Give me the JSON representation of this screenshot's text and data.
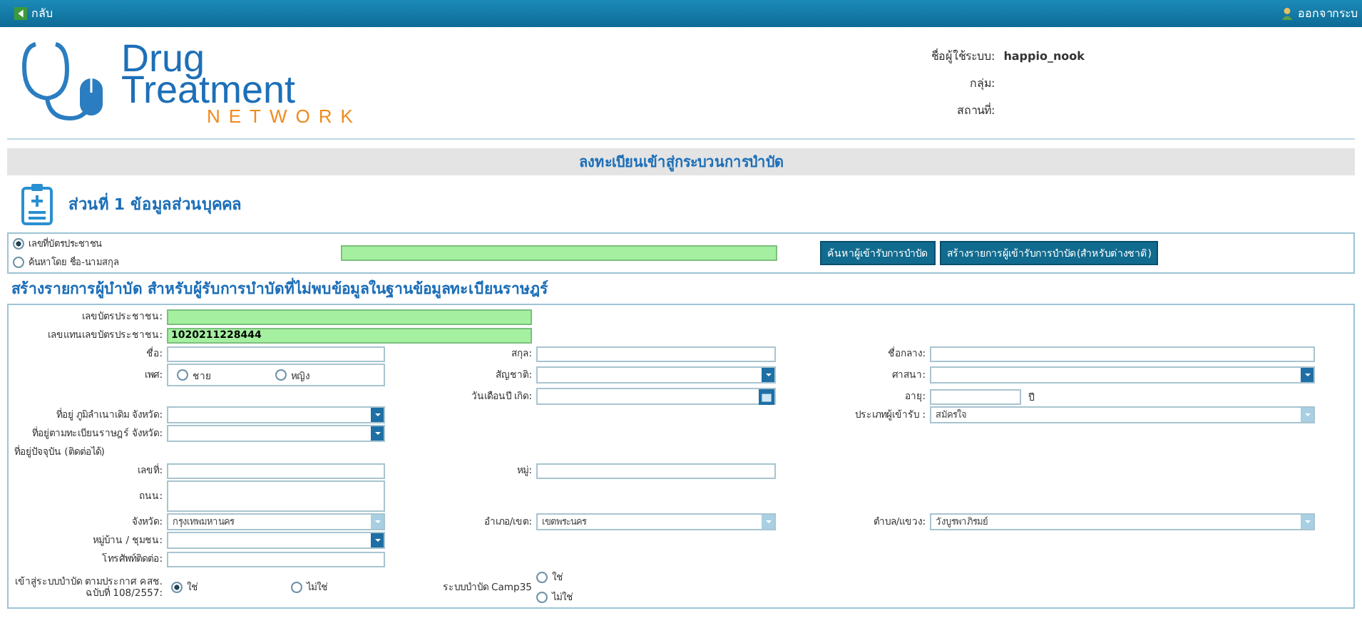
{
  "top_bar": {
    "back": "กลับ",
    "logout": "ออกจากระบ"
  },
  "header": {
    "logo": {
      "line1": "Drug",
      "line2": "Treatment",
      "line3": "NETWORK"
    },
    "user_info": [
      {
        "label": "ชื่อผู้ใช้ระบบ:",
        "value": "happio_nook"
      },
      {
        "label": "กลุ่ม:"
      },
      {
        "label": "สถานที่:"
      }
    ]
  },
  "page_title": "ลงทะเบียนเข้าสู่กระบวนการบำบัด",
  "section_title": "ส่วนที่ 1 ข้อมูลส่วนบุคคล",
  "search": {
    "options": [
      {
        "label": "เลขที่บัตรประชาชน",
        "selected": true
      },
      {
        "label": "ค้นหาโดย ชื่อ-นามสกุล",
        "selected": false
      }
    ],
    "buttons": [
      "ค้นหาผู้เข้ารับการบำบัด",
      "สร้างรายการผู้เข้ารับการบำบัด(สำหรับต่างชาติ)"
    ]
  },
  "form_title": "สร้างรายการผู้บำบัด สำหรับผู้รับการบำบัดที่ไม่พบข้อมูลในฐานข้อมูลทะเบียนราษฎร์",
  "form_rows": [
    {
      "left": {
        "label": "เลขบัตรประชาชน:",
        "kind": "text",
        "wide": true,
        "highlighted": true
      }
    },
    {
      "left": {
        "label": "เลขแทนเลขบัตรประชาชน:",
        "kind": "text",
        "wide": true,
        "highlighted": true,
        "value": "1020211228444"
      }
    },
    {
      "left": {
        "label": "ชื่อ:",
        "kind": "text"
      },
      "middle": {
        "label": "สกุล:",
        "kind": "text"
      },
      "right": {
        "label": "ชื่อกลาง:",
        "kind": "text"
      }
    },
    {
      "left": {
        "label": "เพศ:",
        "kind": "radio",
        "options": [
          {
            "label": "ชาย",
            "selected": false
          },
          {
            "label": "หญิง",
            "selected": false
          }
        ]
      },
      "middle": {
        "label": "สัญชาติ:",
        "kind": "select",
        "disabled": false
      },
      "right": {
        "label": "ศาสนา:",
        "kind": "select",
        "disabled": false
      }
    },
    {
      "middle": {
        "label": "วันเดือนปี เกิด:",
        "kind": "date"
      },
      "right": {
        "label": "อายุ:",
        "kind": "age",
        "unit": "ปี"
      }
    },
    {
      "left": {
        "label": "ที่อยู่ ภูมิลำเนาเดิม จังหวัด:",
        "kind": "select",
        "disabled": false
      },
      "right": {
        "label": "ประเภทผู้เข้ารับ :",
        "kind": "select",
        "disabled": true,
        "value": "สมัครใจ"
      }
    },
    {
      "left": {
        "label": "ที่อยู่ตามทะเบียนราษฎร์ จังหวัด:",
        "kind": "select",
        "disabled": false
      }
    },
    {
      "left": {
        "label": "ที่อยู่ปัจจุบัน (ติดต่อได้)",
        "kind": "heading"
      }
    },
    {
      "left": {
        "label": "เลขที่:",
        "kind": "text"
      },
      "middle": {
        "label": "หมู่:",
        "kind": "text"
      }
    },
    {
      "left": {
        "label": "ถนน:",
        "kind": "textarea"
      }
    },
    {
      "left": {
        "label": "จังหวัด:",
        "kind": "select",
        "disabled": true,
        "value": "กรุงเทพมหานคร"
      },
      "middle": {
        "label": "อำเภอ/เขต:",
        "kind": "select",
        "disabled": true,
        "value": "เขตพระนคร"
      },
      "right": {
        "label": "ตำบล/แขวง:",
        "kind": "select",
        "disabled": true,
        "value": "วังบูรพาภิรมย์"
      }
    },
    {
      "left": {
        "label": "หมู่บ้าน / ชุมชน:",
        "kind": "select",
        "disabled": false
      }
    },
    {
      "left": {
        "label": "โทรศัพท์ติดต่อ:",
        "kind": "text"
      }
    },
    {
      "left": {
        "label": "เข้าสู่ระบบบำบัด ตามประกาศ คสช. ฉบับที่ 108/2557:",
        "kind": "radio-plain",
        "options": [
          {
            "label": "ใช่",
            "selected": true
          },
          {
            "label": "ไม่ใช่",
            "selected": false
          }
        ]
      },
      "middle": {
        "label": "ระบบบำบัด Camp35",
        "kind": "radio-stack",
        "options": [
          {
            "label": "ใช่",
            "selected": false
          },
          {
            "label": "ไม่ใช่",
            "selected": false
          }
        ]
      }
    }
  ]
}
